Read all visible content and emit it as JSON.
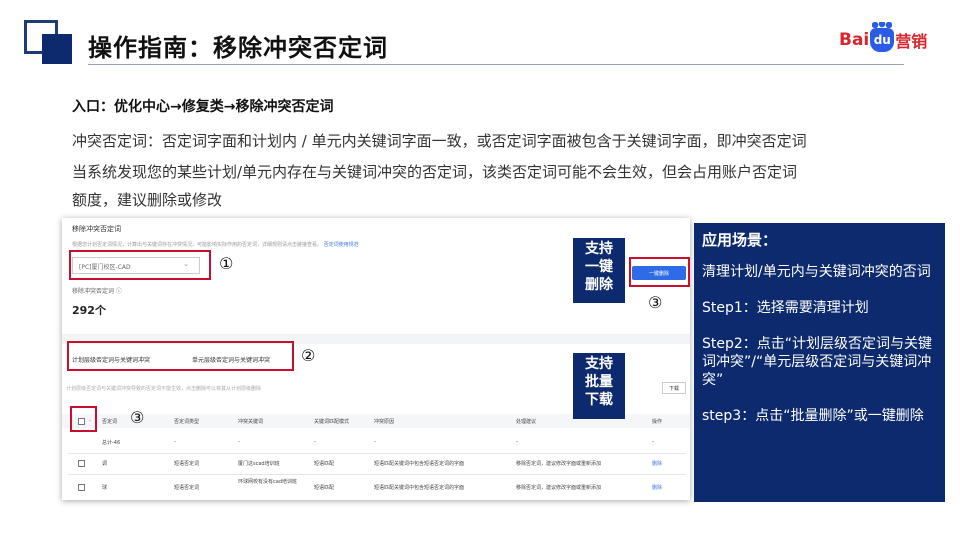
{
  "header": {
    "title": "操作指南：移除冲突否定词",
    "logo_left": "Bai",
    "logo_mid": "du",
    "logo_right": "营销"
  },
  "intro": {
    "entry": "入口：优化中心→修复类→移除冲突否定词",
    "line1": "冲突否定词：否定词字面和计划内 / 单元内关键词字面一致，或否定词字面被包含于关键词字面，即冲突否定词",
    "line2": "当系统发现您的某些计划/单元内存在与关键词冲突的否定词，该类否定词可能不会生效，但会占用账户否定词",
    "line3": "额度，建议删除或修改"
  },
  "shot": {
    "title": "移除冲突否定词",
    "desc": "根据您计划否定词情况，计算出与关键词存在冲突情况，可能影响实际作用的否定词，详细规则请点击链接查看。",
    "desc_link": "否定词使用规范",
    "selector_value": "[PC]厦门校区-CAD",
    "selector_chevron": "⌄",
    "count_label": "移除冲突否定词 ⓘ",
    "count_value": "292个",
    "tab1": "计划层级否定词与关键词冲突",
    "tab2": "单元层级否定词与关键词冲突",
    "warn": "计划层级否定词与关键词冲突导致的否定词不能生效，点击删除可以将其从计划层级删除",
    "btn_delete_all": "一键删除",
    "btn_download": "下载",
    "headers": [
      "否定词",
      "否定词类型",
      "冲突关键词",
      "关键词匹配模式",
      "冲突原因",
      "处理建议",
      "操作"
    ],
    "total_row": {
      "label": "总计-46",
      "placeholder": "-"
    },
    "rows": [
      {
        "word": "调",
        "type": "短语否定词",
        "keyword": "厦门这scad培训班",
        "match": "短语匹配",
        "reason": "短语匹配关键词中包含短语否定词的字面",
        "advice": "移除否定词，建议修改字面或重新添加",
        "op": "删除"
      },
      {
        "word": "球",
        "type": "短语否定词",
        "keyword": "环球网校有没有cad培训班",
        "match": "短语匹配",
        "reason": "短语匹配关键词中包含短语否定词的字面",
        "advice": "移除否定词，建议修改字面或重新添加",
        "op": "删除"
      }
    ]
  },
  "markers": {
    "one": "①",
    "two": "②",
    "three": "③"
  },
  "labels": {
    "oneclick": [
      "支持",
      "一键",
      "删除"
    ],
    "batch": [
      "支持",
      "批量",
      "下载"
    ]
  },
  "side": {
    "title": "应用场景：",
    "p1": "清理计划/单元内与关键词冲突的否词",
    "p2": "Step1：选择需要清理计划",
    "p3": "Step2：点击“计划层级否定词与关键词冲突”/“单元层级否定词与关键词冲突”",
    "p4": "step3：点击“批量删除”或一键删除"
  },
  "colors": {
    "navy": "#0e2a6e",
    "red": "#c8102e",
    "link": "#3b7ae6"
  }
}
